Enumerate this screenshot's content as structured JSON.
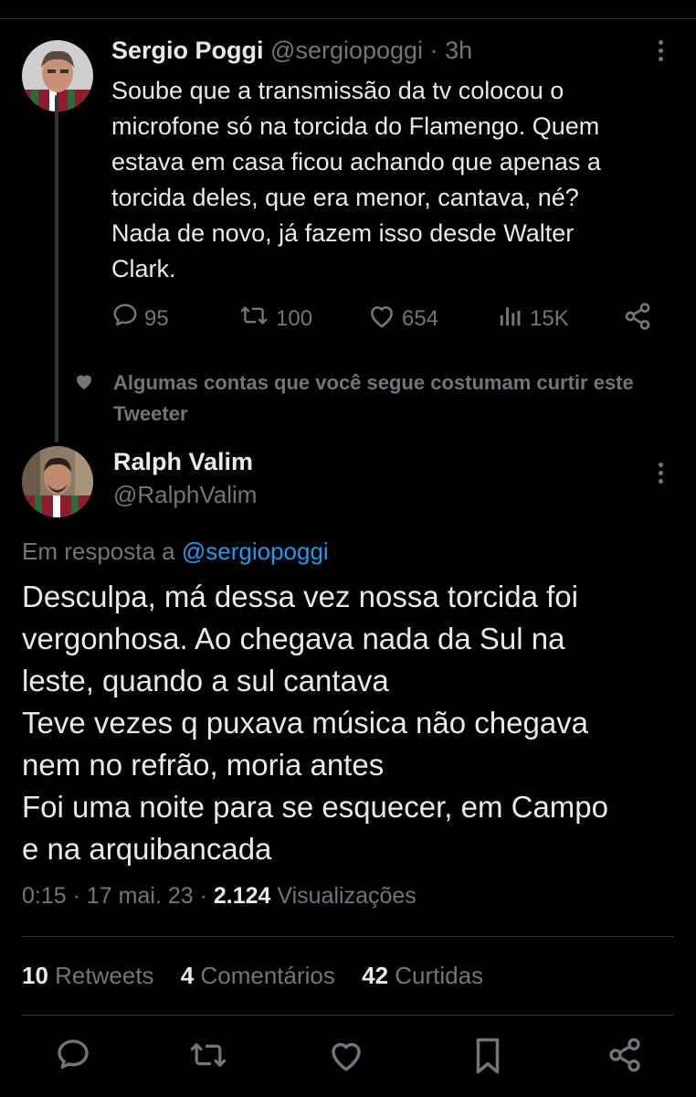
{
  "tweet1": {
    "name": "Sergio Poggi",
    "handle": "@sergiopoggi",
    "separator": "·",
    "time": "3h",
    "text": "Soube que a transmissão da tv colocou o\nmicrofone só na torcida do Flamengo.  Quem\nestava em casa ficou achando que apenas a\ntorcida deles, que era menor, cantava, né?\nNada de novo, já fazem isso desde Walter\nClark.",
    "replies": "95",
    "retweets": "100",
    "likes": "654",
    "views": "15K",
    "icons": {
      "reply": "comment-icon",
      "retweet": "retweet-icon",
      "like": "heart-icon",
      "views": "views-icon",
      "share": "share-icon",
      "more": "more-vertical-icon"
    }
  },
  "social_context": {
    "text": "Algumas contas que você segue costumam curtir este Tweeter",
    "icon": "heart-filled-icon"
  },
  "tweet2": {
    "name": "Ralph Valim",
    "handle": "@RalphValim",
    "reply_prefix": "Em resposta a",
    "reply_mention": "@sergiopoggi",
    "text": "Desculpa, má dessa vez nossa torcida foi\nvergonhosa. Ao chegava nada da Sul na\nleste, quando a sul cantava\nTeve vezes q puxava música não chegava\nnem no refrão, moria antes\nFoi uma noite para se esquecer, em Campo\ne na arquibancada",
    "time": "0:15",
    "date": "17 mai. 23",
    "separator": "·",
    "views_count": "2.124",
    "views_label": "Visualizações",
    "stats": {
      "retweets_count": "10",
      "retweets_label": "Retweets",
      "comments_count": "4",
      "comments_label": "Comentários",
      "likes_count": "42",
      "likes_label": "Curtidas"
    }
  },
  "colors": {
    "background": "#000000",
    "text_primary": "#e7e9ea",
    "text_secondary": "#71767b",
    "link": "#1d9bf0",
    "divider": "#2f3336"
  }
}
